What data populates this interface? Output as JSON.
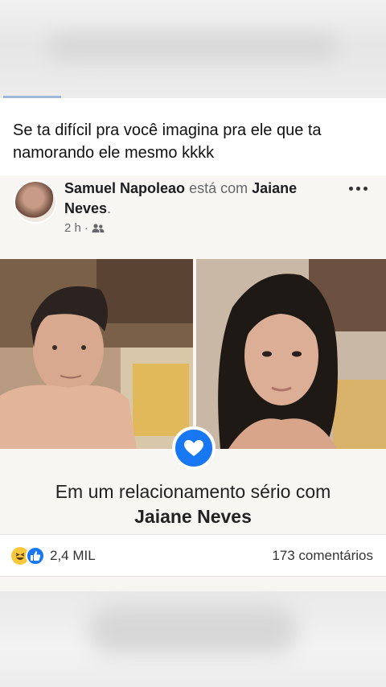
{
  "meme": {
    "caption": "Se ta difícil pra você imagina pra ele que ta namorando ele mesmo kkkk"
  },
  "post": {
    "author": "Samuel Napoleao",
    "verb": "está com",
    "tagged": "Jaiane Neves",
    "tagged_suffix": ".",
    "time": "2 h",
    "separator": "·",
    "privacy_icon": "friends-icon",
    "relationship_line": "Em um relacionamento sério com",
    "relationship_partner": "Jaiane Neves",
    "reaction_icons": [
      "haha-icon",
      "like-icon"
    ],
    "reaction_count": "2,4 MIL",
    "comments": "173 comentários"
  },
  "colors": {
    "facebook_blue": "#1877f2",
    "haha_yellow": "#f7c83b"
  }
}
